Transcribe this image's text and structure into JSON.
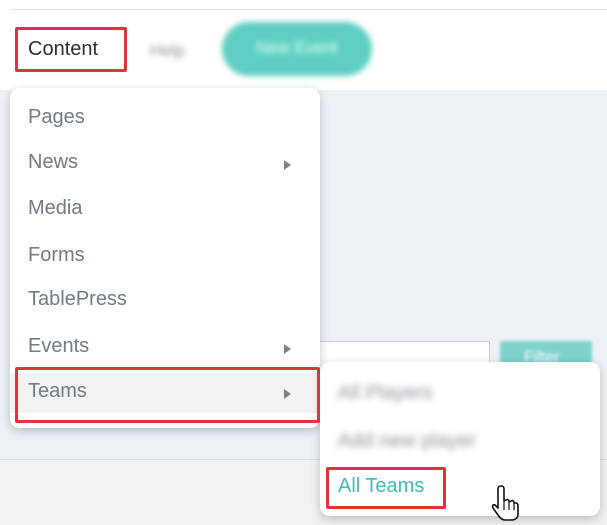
{
  "topbar": {
    "content_label": "Content",
    "blurred_label": "Help",
    "blurred_button": "New Event"
  },
  "menu": {
    "items": [
      {
        "label": "Pages",
        "has_submenu": false
      },
      {
        "label": "News",
        "has_submenu": true
      },
      {
        "label": "Media",
        "has_submenu": false
      },
      {
        "label": "Forms",
        "has_submenu": false
      },
      {
        "label": "TablePress",
        "has_submenu": false
      },
      {
        "label": "Events",
        "has_submenu": true
      },
      {
        "label": "Teams",
        "has_submenu": true
      }
    ]
  },
  "submenu": {
    "items": [
      {
        "label": "All Players",
        "blurred": true
      },
      {
        "label": "Add new player",
        "blurred": true
      },
      {
        "label": "All Teams",
        "blurred": false
      }
    ]
  },
  "page": {
    "filter_button": "Filter"
  },
  "colors": {
    "accent": "#3cbfb3",
    "highlight": "#e2333b",
    "pill": "#5ecfc2"
  }
}
